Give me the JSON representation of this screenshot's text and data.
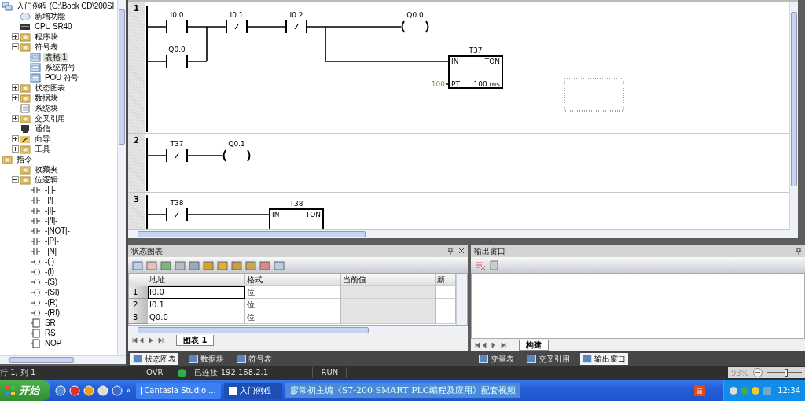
{
  "tree": [
    {
      "label": "入门例程 (G:\\Book CD\\200SI",
      "kind": "project",
      "selected": false,
      "children": [
        {
          "label": "新增功能",
          "kind": "help",
          "selected": false
        },
        {
          "label": "CPU SR40",
          "kind": "cpu",
          "selected": false
        },
        {
          "label": "程序块",
          "kind": "folder",
          "selected": false,
          "expanded": false
        },
        {
          "label": "符号表",
          "kind": "folder",
          "selected": false,
          "expanded": true,
          "children": [
            {
              "label": "表格 1",
              "kind": "table",
              "selected": true
            },
            {
              "label": "系统符号",
              "kind": "table",
              "selected": false
            },
            {
              "label": "POU 符号",
              "kind": "table",
              "selected": false
            }
          ]
        },
        {
          "label": "状态图表",
          "kind": "folder",
          "selected": false,
          "expanded": false
        },
        {
          "label": "数据块",
          "kind": "folder",
          "selected": false,
          "expanded": false
        },
        {
          "label": "系统块",
          "kind": "doc",
          "selected": false
        },
        {
          "label": "交叉引用",
          "kind": "folder",
          "selected": false,
          "expanded": false
        },
        {
          "label": "通信",
          "kind": "monitor",
          "selected": false
        },
        {
          "label": "向导",
          "kind": "wand",
          "selected": false,
          "expanded": false
        },
        {
          "label": "工具",
          "kind": "folder",
          "selected": false,
          "expanded": false
        }
      ]
    },
    {
      "label": "指令",
      "kind": "folder",
      "selected": false,
      "children": [
        {
          "label": "收藏夹",
          "kind": "folder",
          "selected": false
        },
        {
          "label": "位逻辑",
          "kind": "folder",
          "selected": false,
          "expanded": true,
          "children": [
            {
              "label": "-| |-",
              "kind": "contact",
              "selected": false
            },
            {
              "label": "-|/|-",
              "kind": "contact",
              "selected": false
            },
            {
              "label": "-|I|-",
              "kind": "contact",
              "selected": false
            },
            {
              "label": "-|/I|-",
              "kind": "contact",
              "selected": false
            },
            {
              "label": "-|NOT|-",
              "kind": "contact",
              "selected": false
            },
            {
              "label": "-|P|-",
              "kind": "contact",
              "selected": false
            },
            {
              "label": "-|N|-",
              "kind": "contact",
              "selected": false
            },
            {
              "label": "-( )",
              "kind": "coil",
              "selected": false
            },
            {
              "label": "-(I)",
              "kind": "coil",
              "selected": false
            },
            {
              "label": "-(S)",
              "kind": "coil",
              "selected": false
            },
            {
              "label": "-(SI)",
              "kind": "coil",
              "selected": false
            },
            {
              "label": "-(R)",
              "kind": "coil",
              "selected": false
            },
            {
              "label": "-(RI)",
              "kind": "coil",
              "selected": false
            },
            {
              "label": "SR",
              "kind": "box",
              "selected": false
            },
            {
              "label": "RS",
              "kind": "box",
              "selected": false
            },
            {
              "label": "NOP",
              "kind": "box",
              "selected": false
            }
          ]
        }
      ]
    }
  ],
  "networks": [
    {
      "number": "1",
      "elements": [
        {
          "kind": "no",
          "label": "I0.0"
        },
        {
          "kind": "no",
          "label": "Q0.0"
        },
        {
          "kind": "nc",
          "label": "I0.1"
        },
        {
          "kind": "nc",
          "label": "I0.2"
        },
        {
          "kind": "coil",
          "label": "Q0.0"
        },
        {
          "kind": "timer",
          "label": "T37",
          "in": "IN",
          "type": "TON",
          "pt": "PT",
          "base": "100 ms",
          "preset": "100"
        }
      ]
    },
    {
      "number": "2",
      "elements": [
        {
          "kind": "nc",
          "label": "T37"
        },
        {
          "kind": "coil",
          "label": "Q0.1"
        }
      ]
    },
    {
      "number": "3",
      "elements": [
        {
          "kind": "nc",
          "label": "T38"
        },
        {
          "kind": "timer",
          "label": "T38",
          "in": "IN",
          "type": "TON"
        }
      ]
    }
  ],
  "status_chart": {
    "title": "状态图表",
    "columns": [
      "地址",
      "格式",
      "当前值",
      "新"
    ],
    "rows": [
      {
        "number": "1",
        "address": "I0.0",
        "format": "位",
        "selected": true
      },
      {
        "number": "2",
        "address": "I0.1",
        "format": "位",
        "selected": false
      },
      {
        "number": "3",
        "address": "Q0.0",
        "format": "位",
        "selected": false
      }
    ],
    "sheet_tab": "图表 1"
  },
  "output_window": {
    "title": "输出窗口",
    "sheet_tab": "构建"
  },
  "panel_tabs_left": [
    {
      "label": "状态图表",
      "selected": true
    },
    {
      "label": "数据块",
      "selected": false
    },
    {
      "label": "符号表",
      "selected": false
    }
  ],
  "panel_tabs_right": [
    {
      "label": "变量表",
      "selected": false
    },
    {
      "label": "交叉引用",
      "selected": false
    },
    {
      "label": "输出窗口",
      "selected": true
    }
  ],
  "status_bar": {
    "position": "行 1, 列 1",
    "mode": "OVR",
    "connected": true,
    "connection": "已连接 192.168.2.1",
    "cpu_state": "RUN",
    "zoom": "93%",
    "level": 0.55
  },
  "taskbar": {
    "start": "开始",
    "more": "»",
    "tasks": [
      {
        "label": "Cantasia Studio ...",
        "selected": false
      },
      {
        "label": "入门例程",
        "selected": true
      }
    ],
    "caption": "廖常初主编《S7-200 SMART PLC编程及应用》配套视频",
    "clock": "12:34"
  }
}
